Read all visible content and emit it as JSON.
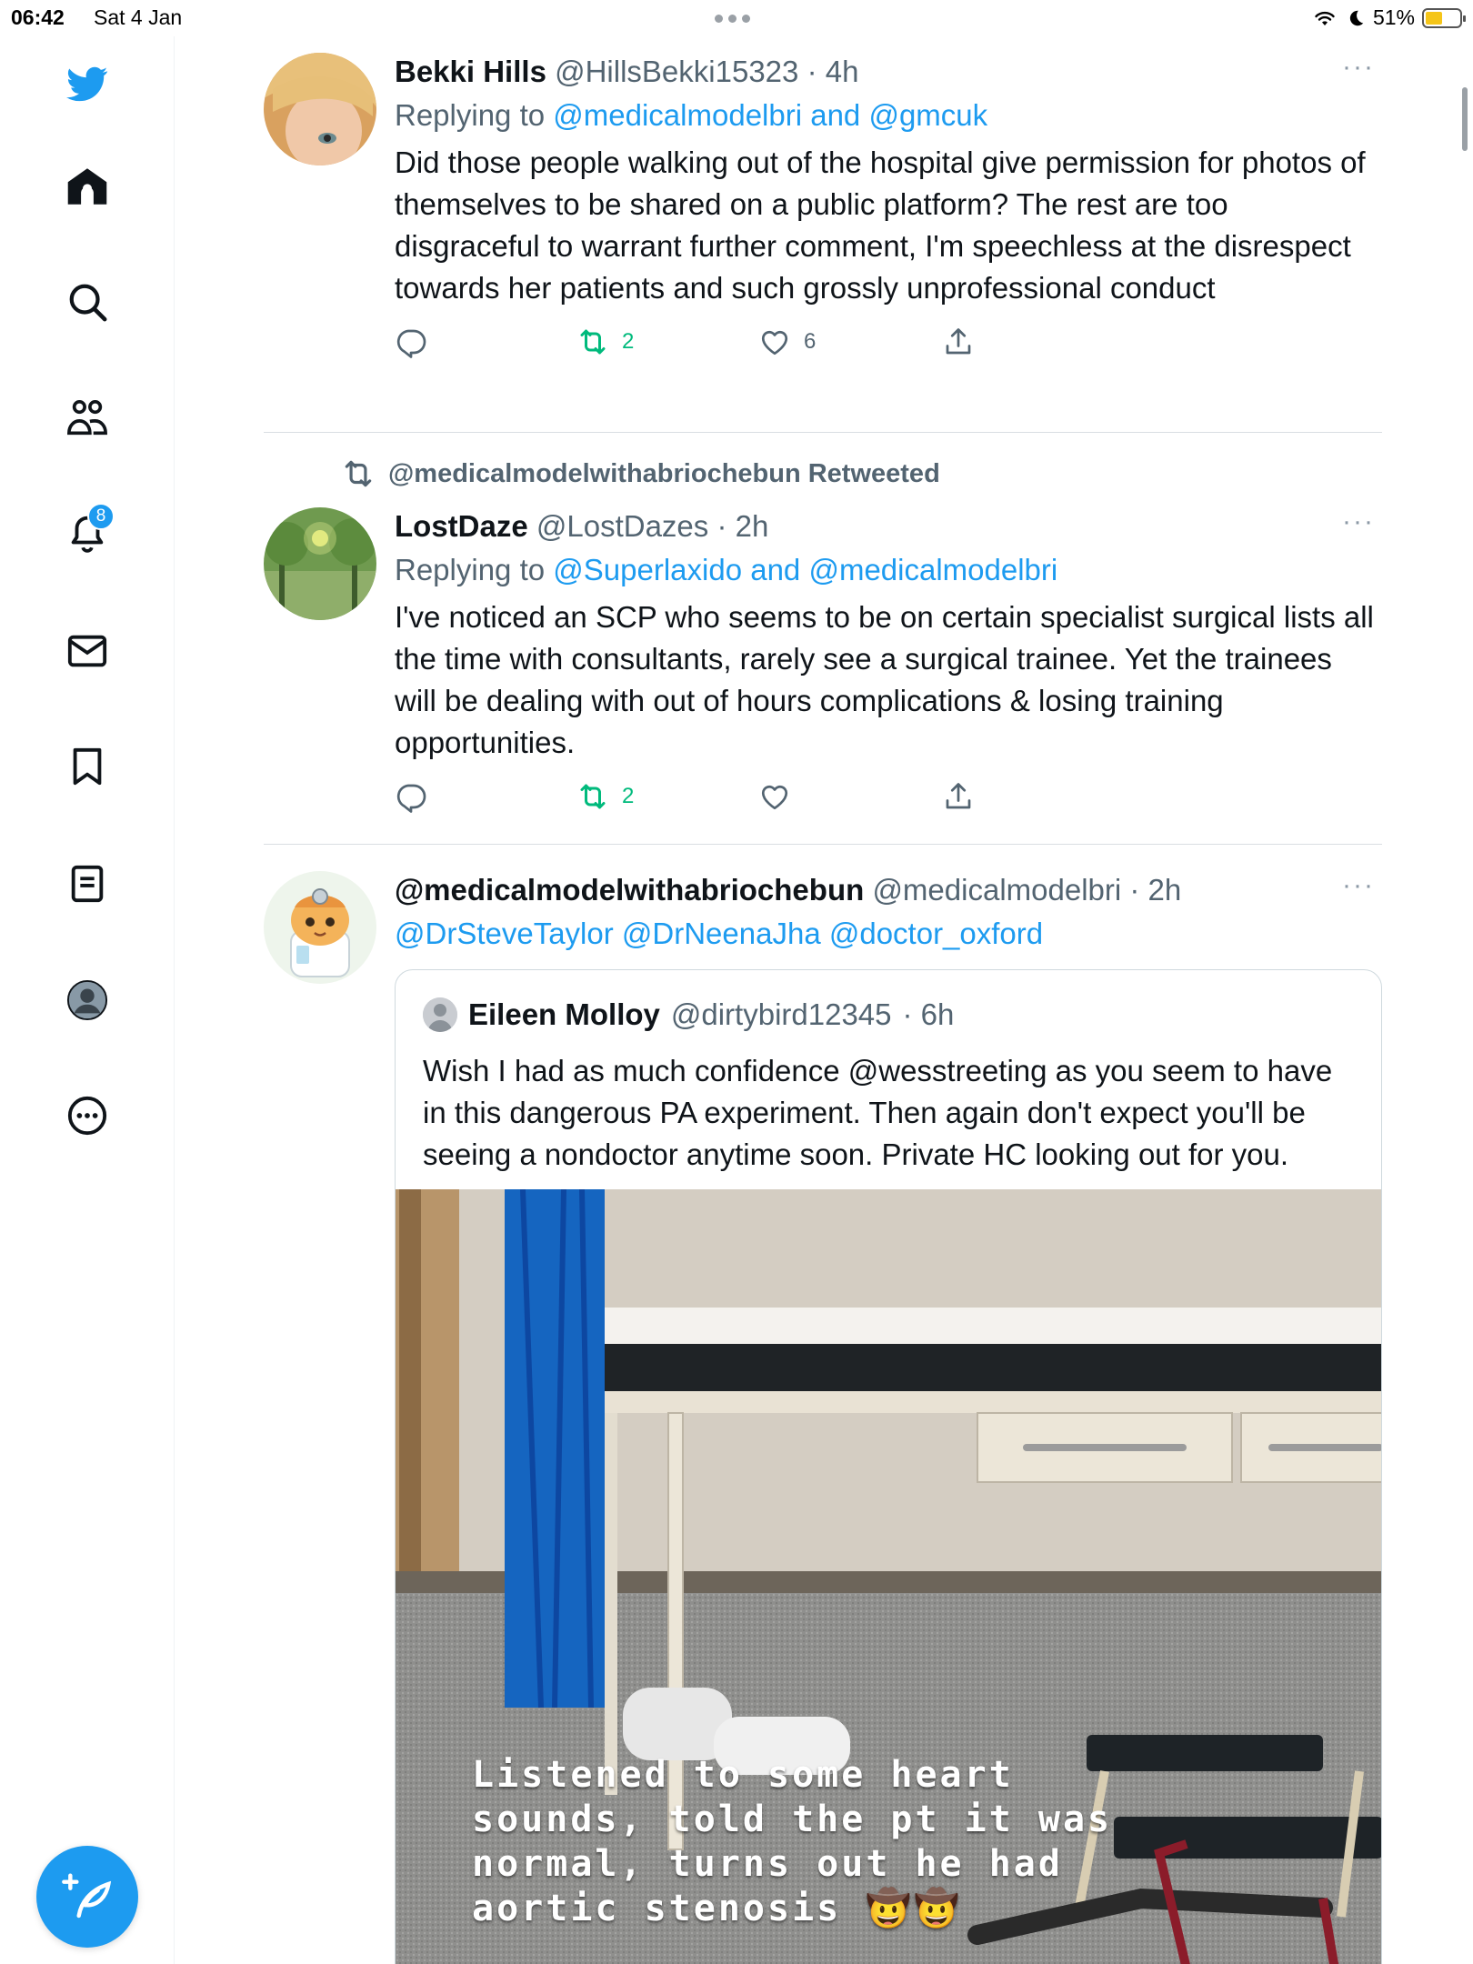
{
  "status_bar": {
    "time": "06:42",
    "date": "Sat 4 Jan",
    "battery": "51%"
  },
  "sidebar": {
    "items": [
      {
        "icon": "twitter-logo-icon"
      },
      {
        "icon": "home-icon"
      },
      {
        "icon": "search-icon"
      },
      {
        "icon": "communities-icon"
      },
      {
        "icon": "notifications-icon",
        "badge": "8"
      },
      {
        "icon": "messages-icon"
      },
      {
        "icon": "bookmarks-icon"
      },
      {
        "icon": "lists-icon"
      },
      {
        "icon": "profile-icon"
      },
      {
        "icon": "more-icon"
      }
    ],
    "compose_icon": "compose-tweet-icon"
  },
  "tweets": [
    {
      "name": "Bekki Hills",
      "handle": "@HillsBekki15323",
      "time": "· 4h",
      "replying_prefix": "Replying to",
      "replying_to": "@medicalmodelbri and @gmcuk",
      "text": "Did those people walking out of the hospital give permission for photos of themselves to be shared on a public platform? The rest are too disgraceful to warrant further comment, I'm speechless at the disrespect towards her patients and such grossly unprofessional conduct",
      "retweets": "2",
      "likes": "6"
    },
    {
      "retweeted_by": "@medicalmodelwithabriochebun Retweeted",
      "name": "LostDaze",
      "handle": "@LostDazes",
      "time": "· 2h",
      "replying_prefix": "Replying to",
      "replying_to": "@Superlaxido and @medicalmodelbri",
      "text": "I've noticed an SCP who seems to be on certain specialist surgical lists all the time with consultants, rarely see a surgical trainee. Yet the trainees will be dealing with out of hours complications & losing training opportunities.",
      "retweets": "2",
      "likes": ""
    },
    {
      "name": "@medicalmodelwithabriochebun",
      "handle": "@medicalmodelbri",
      "time": "· 2h",
      "mentions": "@DrSteveTaylor @DrNeenaJha @doctor_oxford",
      "quote": {
        "name": "Eileen Molloy",
        "handle": "@dirtybird12345",
        "time": "· 6h",
        "text": "Wish I had as much confidence @wesstreeting as you seem to have in this dangerous PA experiment. Then again don't expect you'll be seeing a nondoctor anytime soon. Private HC looking out for you.",
        "image_caption_lines": [
          "Listened to some heart",
          "sounds, told the pt it was",
          "normal, turns out he had",
          "aortic stenosis 🤠🤠"
        ]
      }
    }
  ],
  "colors": {
    "accent": "#1d9bf0",
    "retweet_green": "#00ba7c",
    "secondary_text": "#536471"
  }
}
